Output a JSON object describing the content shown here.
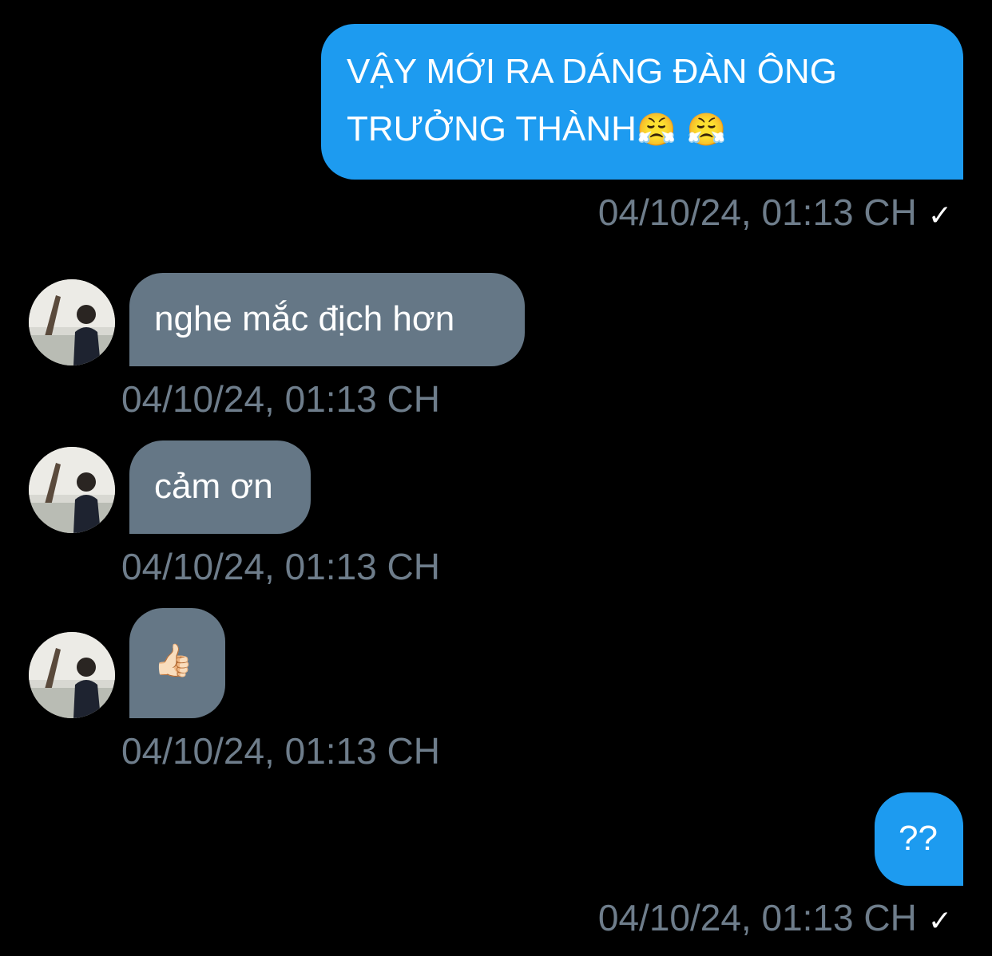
{
  "messages": [
    {
      "direction": "sent",
      "text_line1": "VẬY MỚI RA DÁNG ĐÀN ÔNG",
      "text_line2": "TRƯỞNG THÀNH",
      "emojis": "😤 😤",
      "timestamp": "04/10/24, 01:13 CH",
      "status": "✓"
    },
    {
      "direction": "received",
      "text": "nghe mắc địch hơn",
      "timestamp": "04/10/24, 01:13 CH"
    },
    {
      "direction": "received",
      "text": "cảm ơn",
      "timestamp": "04/10/24, 01:13 CH"
    },
    {
      "direction": "received",
      "text": "👍🏻",
      "timestamp": "04/10/24, 01:13 CH"
    },
    {
      "direction": "sent",
      "text": "??",
      "timestamp": "04/10/24, 01:13 CH",
      "status": "✓"
    }
  ],
  "colors": {
    "background": "#000000",
    "sent_bubble": "#1d9bf0",
    "received_bubble": "#657786",
    "timestamp": "#6e7d8b"
  },
  "icons": {
    "avatar": "contact-avatar-photo",
    "read_check": "check-icon"
  }
}
